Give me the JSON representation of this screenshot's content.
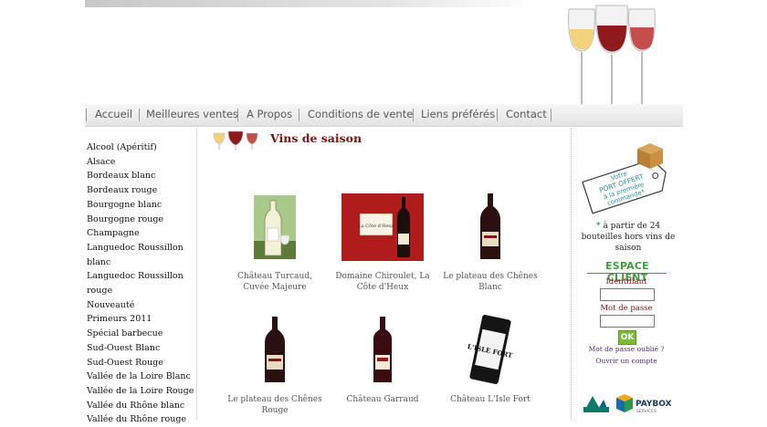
{
  "nav": [
    "Accueil",
    "Meilleures ventes",
    "A Propos",
    "Conditions de vente",
    "Liens préférés",
    "Contact"
  ],
  "sidebar": [
    "Alcool (Apéritif)",
    "Alsace",
    "Bordeaux blanc",
    "Bordeaux rouge",
    "Bourgogne blanc",
    "Bourgogne rouge",
    "Champagne",
    "Languedoc Roussillon blanc",
    "Languedoc Roussillon rouge",
    "Nouveauté",
    "Primeurs 2011",
    "Spécial barbecue",
    "Sud-Ouest Blanc",
    "Sud-Ouest Rouge",
    "Vallée de la Loire Blanc",
    "Vallée de la Loire Rouge",
    "Vallée du Rhône blanc",
    "Vallée du Rhône rouge"
  ],
  "section_title": "Vins de saison",
  "products": [
    {
      "name": "Château Turcaud, Cuvée Majeure"
    },
    {
      "name": "Domaine Chiroulet, La Côte d'Heux",
      "label_text": "La Côte d'Heux"
    },
    {
      "name": "Le plateau des Chênes Blanc"
    },
    {
      "name": "Le plateau des Chênes Rouge"
    },
    {
      "name": "Château Garraud"
    },
    {
      "name": "Château L'Isle Fort",
      "label_text": "L'ISLE FORT"
    }
  ],
  "promo": {
    "badge": [
      "Votre",
      "PORT OFFERT",
      "à la première",
      "commande*"
    ],
    "star": "*",
    "note": "à partir de 24 bouteilles hors vins de saison"
  },
  "login": {
    "title": "ESPACE CLIENT",
    "identifiant_label": "Identifiant",
    "password_label": "Mot de passe",
    "ok": "OK",
    "forgot": "Mot de passe oublié ?",
    "open_account": "Ouvrir un compte"
  },
  "logos": {
    "paybox": "PAYBOX",
    "paybox_sub": "SERVICES"
  },
  "colors": {
    "accent": "#7a1010",
    "green": "#3c9e3c",
    "purple_link": "#4a2a7a"
  }
}
